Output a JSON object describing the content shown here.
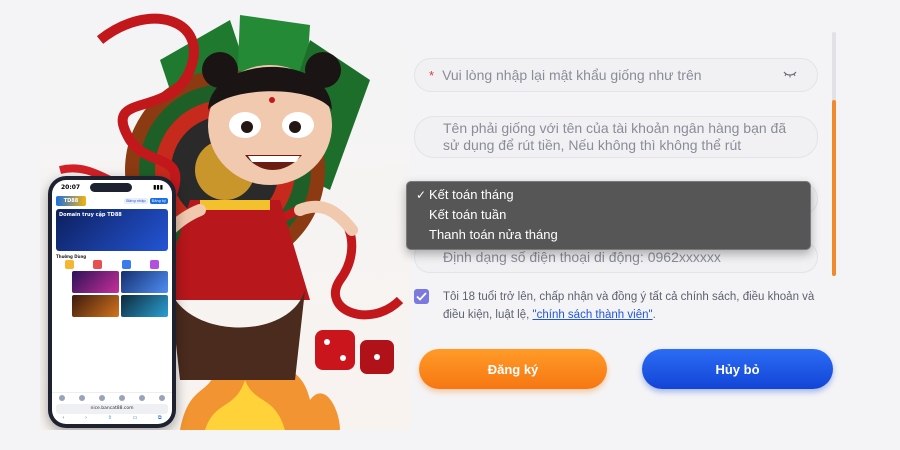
{
  "form": {
    "confirm_password_placeholder": "Vui lòng nhập lại mật khẩu giống như trên",
    "required_marker": "*",
    "fullname_placeholder_line1": "Tên phải giống với tên của tài khoản ngân hàng bạn đã",
    "fullname_placeholder_line2": "sử dụng để rút tiền, Nếu không thì không thể rút",
    "phone_placeholder": "Định dạng số điện thoại di động: 0962xxxxxx",
    "cycle_dropdown": {
      "selected_index": 0,
      "check_mark": "✓",
      "options": [
        "Kết toán tháng",
        "Kết toán tuần",
        "Thanh toán nửa tháng"
      ]
    },
    "consent": {
      "checked": true,
      "text": "Tôi 18 tuổi trở lên, chấp nhận và đồng ý tất cả chính sách, điều khoản và điều kiện, luật lệ, ",
      "link": "\"chính sách thành viên\"",
      "suffix": "."
    },
    "register_button": "Đăng ký",
    "cancel_button": "Hủy bỏ"
  },
  "phone_mockup": {
    "time": "20:07",
    "logo": "TD88",
    "login_button": "Đăng nhập",
    "signup_button": "Đăng ký",
    "banner_text": "Domain truy cập TD88",
    "section_title": "Thường Dùng",
    "url": "nice.bancat88.com"
  },
  "colors": {
    "accent_orange": "#f77712",
    "accent_blue": "#1244d6",
    "checkbox": "#7b79e0",
    "link": "#1f55e0",
    "required": "#e23a3a"
  },
  "icons": [
    "eye-closed-icon",
    "chevron-down-icon",
    "check-icon",
    "checkbox-check-icon"
  ]
}
